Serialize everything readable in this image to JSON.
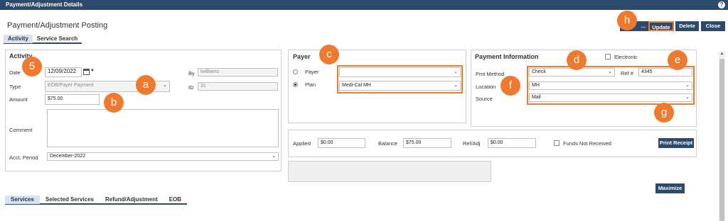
{
  "window": {
    "title": "Payment/Adjustment Details",
    "help_icon": "?"
  },
  "page_title": "Payment/Adjustment Posting",
  "top_tabs": [
    "Activity",
    "Service Search"
  ],
  "toolbar": {
    "truncated_label": "...",
    "update": "Update",
    "delete": "Delete",
    "close": "Close"
  },
  "activity": {
    "title": "Activity",
    "date_label": "Date",
    "date_value": "12/09/2022",
    "type_label": "Type",
    "type_value": "EOB/Payer Payment",
    "amount_label": "Amount",
    "amount_value": "$75.00",
    "comment_label": "Comment",
    "by_label": "By",
    "by_value": "lwilliams",
    "id_label": "ID",
    "id_value": "31",
    "acct_period_label": "Acct. Period",
    "acct_period_value": "December-2022"
  },
  "payer": {
    "title": "Payer",
    "payer_label": "Payer",
    "payer_value": "",
    "plan_label": "Plan",
    "plan_value": "Medi-Cal MH"
  },
  "payment_info": {
    "title": "Payment Information",
    "electronic_label": "Electronic",
    "pmt_method_label": "Pmt Method",
    "pmt_method_value": "Check",
    "ref_label": "Ref #",
    "ref_value": "4345",
    "location_label": "Location",
    "location_value": "MH",
    "source_label": "Source",
    "source_value": "Mail"
  },
  "totals": {
    "applied_label": "Applied",
    "applied_value": "$0.00",
    "balance_label": "Balance",
    "balance_value": "$75.00",
    "refadj_label": "Ref/Adj",
    "refadj_value": "$0.00",
    "funds_label": "Funds Not Received",
    "print_receipt": "Print Receipt"
  },
  "maximize_label": "Maximize",
  "bottom_tabs": [
    "Services",
    "Selected Services",
    "Refund/Adjustment",
    "EOB"
  ],
  "badges": {
    "five": "5",
    "a": "a",
    "b": "b",
    "c": "c",
    "d": "d",
    "e": "e",
    "f": "f",
    "g": "g",
    "h": "h"
  },
  "colors": {
    "header": "#2e4a6b",
    "highlight": "#ee7a30",
    "tab_active": "#d7e3f3"
  }
}
